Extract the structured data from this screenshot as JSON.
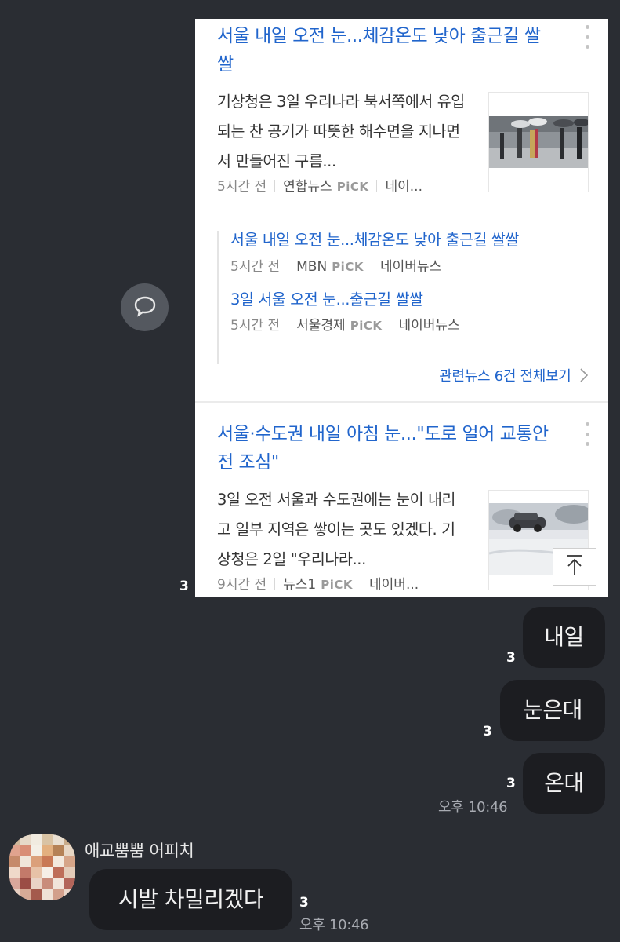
{
  "news": {
    "articles": [
      {
        "title": "서울 내일 오전 눈...체감온도 낮아 출근길 쌀쌀",
        "summary": "기상청은 3일 우리나라 북서쪽에서 유입되는 찬 공기가 따뜻한 해수면을 지나면서 만들어진 구름...",
        "age": "5시간 전",
        "source": "연합뉴스",
        "pick": "PiCK",
        "platform": "네이...",
        "thumbnail": "snowy-street-umbrellas-photo"
      },
      {
        "title": "서울·수도권 내일 아침 눈...\"도로 얼어 교통안전 조심\"",
        "summary": "3일 오전 서울과 수도권에는 눈이 내리고 일부 지역은 쌓이는 곳도 있겠다. 기상청은 2일 \"우리나라...",
        "age": "9시간 전",
        "source": "뉴스1",
        "pick": "PiCK",
        "platform": "네이버...",
        "thumbnail": "car-in-snow-photo"
      }
    ],
    "related": [
      {
        "title": "서울 내일 오전 눈...체감온도 낮아 출근길 쌀쌀",
        "age": "5시간 전",
        "source": "MBN",
        "pick": "PiCK",
        "platform": "네이버뉴스"
      },
      {
        "title": "3일 서울 오전 눈...출근길 쌀쌀",
        "age": "5시간 전",
        "source": "서울경제",
        "pick": "PiCK",
        "platform": "네이버뉴스"
      }
    ],
    "more_link": "관련뉴스 6건 전체보기",
    "unread": "3"
  },
  "messages": {
    "sent": [
      {
        "text": "내일",
        "unread": "3"
      },
      {
        "text": "눈은대",
        "unread": "3"
      },
      {
        "text": "온대",
        "unread": "3",
        "time": "오후 10:46"
      }
    ],
    "received": {
      "sender": "애교뿜뿜 어피치",
      "text": "시발 차밀리겠다",
      "unread": "3",
      "time": "오후 10:46"
    }
  },
  "colors": {
    "background": "#2a2d33",
    "bubble": "#1c1d21",
    "link": "#2165cc"
  }
}
